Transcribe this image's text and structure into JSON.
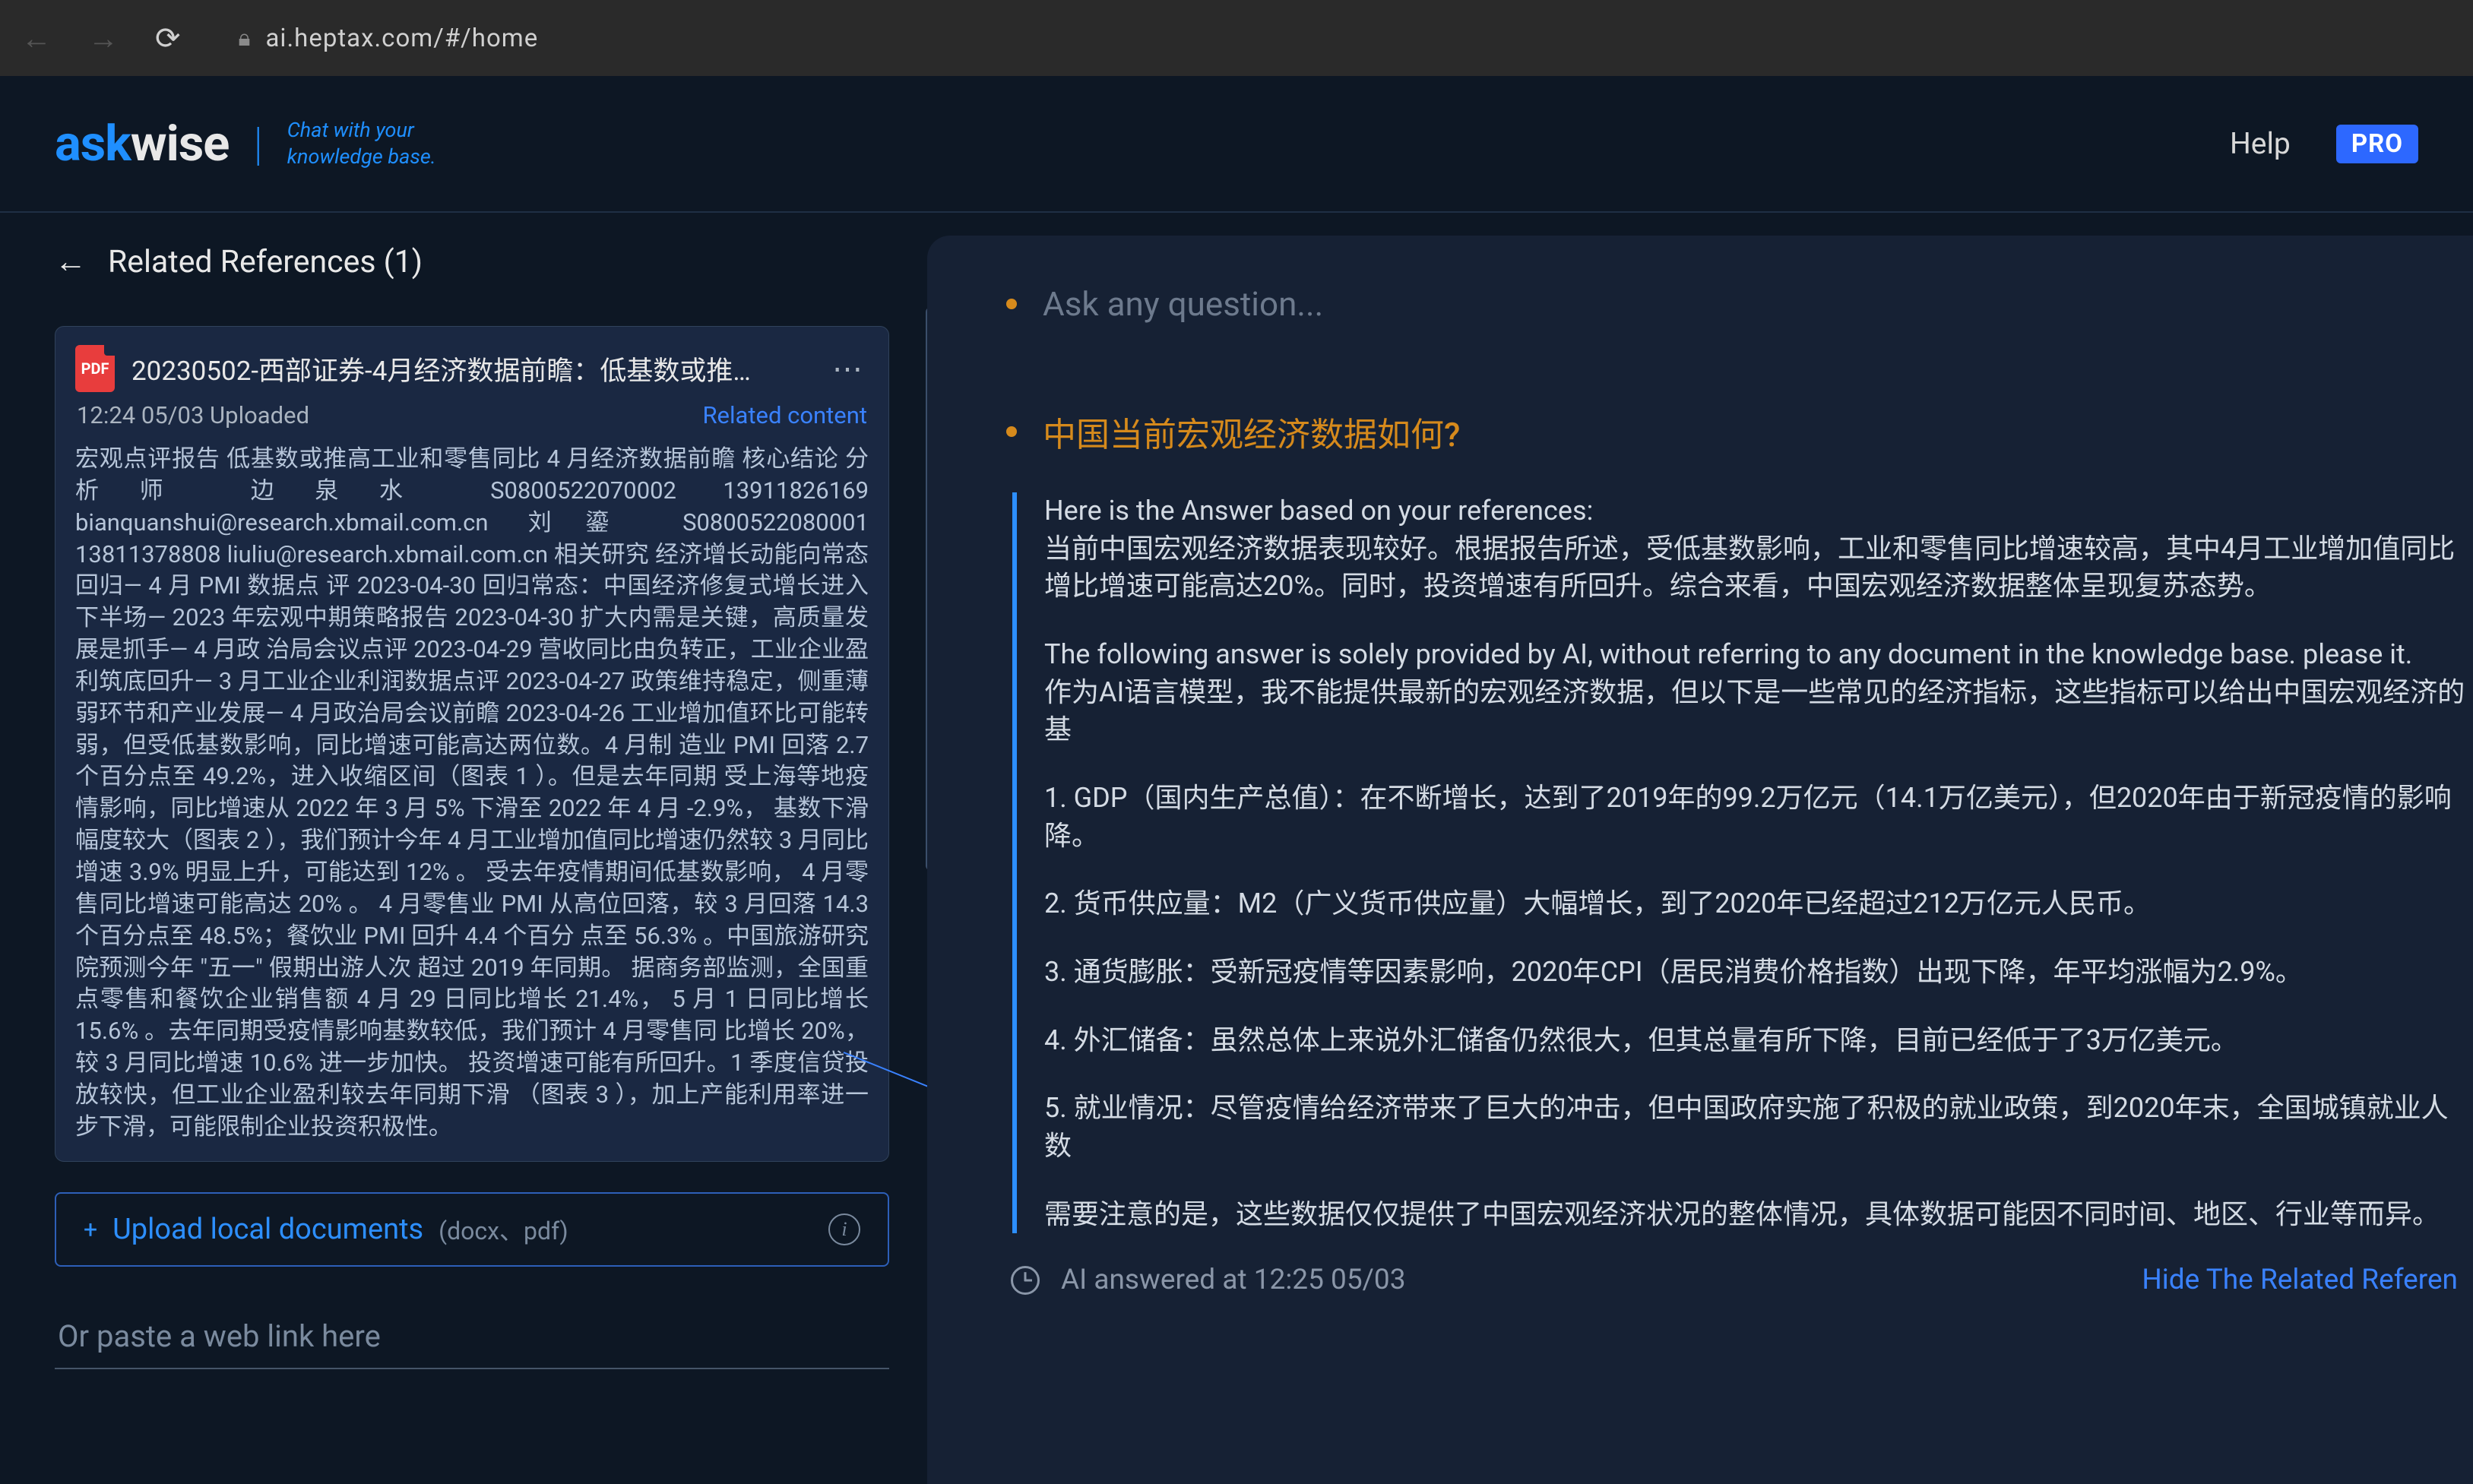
{
  "browser": {
    "url": "ai.heptax.com/#/home"
  },
  "header": {
    "logo_ask": "ask",
    "logo_wise": "wise",
    "tagline_l1": "Chat with your",
    "tagline_l2": "knowledge base.",
    "help": "Help",
    "pro": "PRO"
  },
  "refs": {
    "back_title": "Related References  (1)",
    "card": {
      "pdf_badge": "PDF",
      "title": "20230502-西部证券-4月经济数据前瞻：低基数或推…",
      "uploaded": "12:24 05/03 Uploaded",
      "related": "Related content",
      "excerpt": "宏观点评报告 低基数或推高工业和零售同比 4 月经济数据前瞻  核心结论 分析师 边泉水 S0800522070002 13911826169 bianquanshui@research.xbmail.com.cn 刘鎏 S0800522080001 13811378808 liuliu@research.xbmail.com.cn 相关研究 经济增长动能向常态回归— 4 月 PMI 数据点 评 2023-04-30 回归常态：中国经济修复式增长进入下半场— 2023 年宏观中期策略报告 2023-04-30 扩大内需是关键，高质量发展是抓手— 4 月政 治局会议点评 2023-04-29 营收同比由负转正，工业企业盈利筑底回升— 3 月工业企业利润数据点评 2023-04-27 政策维持稳定，侧重薄弱环节和产业发展— 4 月政治局会议前瞻 2023-04-26 工业增加值环比可能转弱，但受低基数影响，同比增速可能高达两位数。4 月制 造业 PMI 回落 2.7 个百分点至 49.2%，进入收缩区间（图表 1 ）。但是去年同期 受上海等地疫情影响，同比增速从 2022 年 3 月 5% 下滑至 2022 年 4 月 -2.9%， 基数下滑幅度较大（图表 2 ），我们预计今年 4 月工业增加值同比增速仍然较 3 月同比增速 3.9% 明显上升，可能达到 12% 。 受去年疫情期间低基数影响， 4 月零售同比增速可能高达 20% 。 4 月零售业 PMI 从高位回落，较 3 月回落 14.3 个百分点至 48.5%；餐饮业 PMI 回升 4.4 个百分 点至 56.3% 。中国旅游研究院预测今年 \"五一\" 假期出游人次 超过 2019 年同期。 据商务部监测，全国重点零售和餐饮企业销售额 4 月 29 日同比增长 21.4%， 5 月 1 日同比增长 15.6% 。去年同期受疫情影响基数较低，我们预计 4 月零售同 比增长 20%，较 3 月同比增速 10.6% 进一步加快。 投资增速可能有所回升。1 季度信贷投放较快，但工业企业盈利较去年同期下滑 （图表 3 ），加上产能利用率进一步下滑，可能限制企业投资积极性。"
    },
    "upload": {
      "label": "Upload local documents",
      "formats": "(docx、pdf)"
    },
    "paste_placeholder": "Or paste a web link here"
  },
  "chat": {
    "ask_placeholder": "Ask any question...",
    "question": "中国当前宏观经济数据如何?",
    "answer": {
      "p1": "Here is the Answer based on your references:",
      "p2": "当前中国宏观经济数据表现较好。根据报告所述，受低基数影响，工业和零售同比增速较高，其中4月工业增加值同比增比增速可能高达20%。同时，投资增速有所回升。综合来看，中国宏观经济数据整体呈现复苏态势。",
      "p3": "The following answer is solely provided by AI, without referring to any document in the knowledge base. please it.",
      "p4": "作为AI语言模型，我不能提供最新的宏观经济数据，但以下是一些常见的经济指标，这些指标可以给出中国宏观经济的基",
      "p5": "1. GDP（国内生产总值）：在不断增长，达到了2019年的99.2万亿元（14.1万亿美元），但2020年由于新冠疫情的影响降。",
      "p6": "2. 货币供应量：M2（广义货币供应量）大幅增长，到了2020年已经超过212万亿元人民币。",
      "p7": "3. 通货膨胀：受新冠疫情等因素影响，2020年CPI（居民消费价格指数）出现下降，年平均涨幅为2.9%。",
      "p8": "4. 外汇储备：虽然总体上来说外汇储备仍然很大，但其总量有所下降，目前已经低于了3万亿美元。",
      "p9": "5. 就业情况：尽管疫情给经济带来了巨大的冲击，但中国政府实施了积极的就业政策，到2020年末，全国城镇就业人数",
      "p10": "需要注意的是，这些数据仅仅提供了中国宏观经济状况的整体情况，具体数据可能因不同时间、地区、行业等而异。"
    },
    "answered_at": "AI answered at 12:25 05/03",
    "hide": "Hide The Related Referen"
  }
}
